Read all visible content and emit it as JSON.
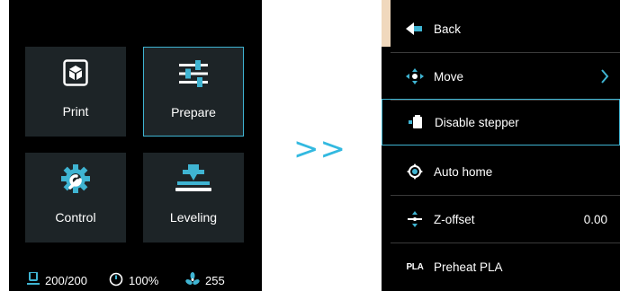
{
  "home_screen": {
    "tiles": [
      {
        "label": "Print",
        "icon": "cube-box-icon"
      },
      {
        "label": "Prepare",
        "icon": "sliders-icon"
      },
      {
        "label": "Control",
        "icon": "gear-wrench-icon"
      },
      {
        "label": "Leveling",
        "icon": "leveling-bed-icon"
      }
    ],
    "status": {
      "temperature": "200/200",
      "speed": "100%",
      "fan": "255"
    }
  },
  "transition": ">>",
  "prepare_menu": {
    "items": [
      {
        "label": "Back",
        "icon": "back-arrow-icon"
      },
      {
        "label": "Move",
        "icon": "move-arrows-icon"
      },
      {
        "label": "Disable stepper",
        "icon": "stepper-motor-icon"
      },
      {
        "label": "Auto home",
        "icon": "home-target-icon"
      },
      {
        "label": "Z-offset",
        "icon": "z-offset-icon",
        "value": "0.00"
      },
      {
        "label": "Preheat PLA",
        "icon": "PLA"
      }
    ]
  },
  "colors": {
    "accent": "#3fb4d2",
    "tile_bg": "#1d2427",
    "back_marker": "#f0d8bd"
  }
}
